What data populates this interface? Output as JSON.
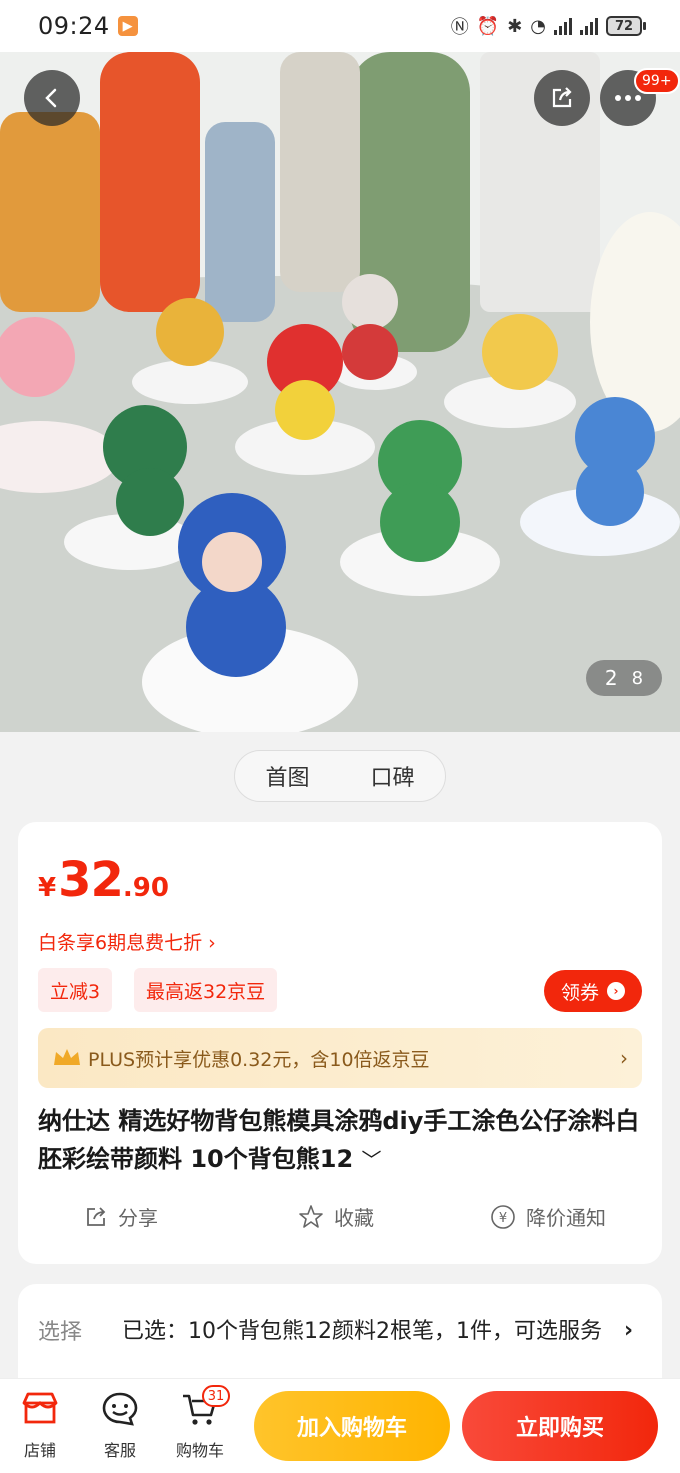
{
  "status_bar": {
    "time": "09:24",
    "battery": "72",
    "network": "4G"
  },
  "hero": {
    "counter_current": "2",
    "counter_total": "8",
    "badge": "99+"
  },
  "tabs": [
    {
      "label": "首图"
    },
    {
      "label": "口碑"
    }
  ],
  "product": {
    "currency": "¥",
    "price_int": "32",
    "price_dec": ".90",
    "baitiao": "白条享6期息费七折 ›",
    "promos": [
      "立减3",
      "最高返32京豆"
    ],
    "coupon_label": "领券",
    "plus_text": "PLUS预计享优惠0.32元，含10倍返京豆",
    "title": "纳仕达 精选好物背包熊模具涂鸦diy手工涂色公仔涂料白胚彩绘带颜料 10个背包熊12",
    "actions": {
      "share": "分享",
      "favorite": "收藏",
      "price_alert": "降价通知"
    }
  },
  "selection": {
    "label": "选择",
    "value": "已选：10个背包熊12颜料2根笔，1件，可选服务"
  },
  "bottom_bar": {
    "shop": "店铺",
    "service": "客服",
    "cart": "购物车",
    "cart_count": "31",
    "add_to_cart": "加入购物车",
    "buy_now": "立即购买"
  },
  "colors": {
    "accent": "#f2270c",
    "yellow": "#ffb400",
    "plus_text": "#8a5a1c"
  },
  "icons": [
    "back-icon",
    "share-icon",
    "more-icon",
    "crown-icon",
    "share-action-icon",
    "star-icon",
    "yen-circle-icon",
    "shop-icon",
    "service-icon",
    "cart-icon"
  ]
}
